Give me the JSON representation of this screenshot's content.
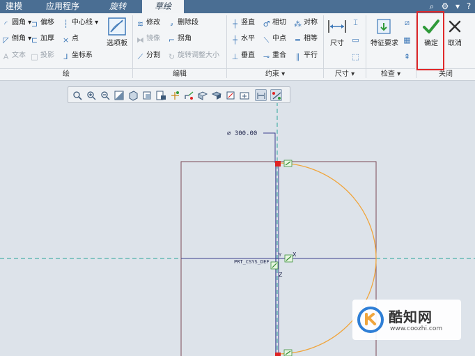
{
  "tabs": [
    {
      "label": "建模"
    },
    {
      "label": "应用程序"
    },
    {
      "label": "旋转"
    },
    {
      "label": "草绘"
    }
  ],
  "ribbon": {
    "sketch_group": {
      "footer": "绘",
      "items": [
        {
          "label": "圆角",
          "icon": "fillet-icon"
        },
        {
          "label": "倒角",
          "icon": "chamfer-icon"
        },
        {
          "label": "文本",
          "icon": "text-icon"
        },
        {
          "label": "偏移",
          "icon": "offset-icon"
        },
        {
          "label": "加厚",
          "icon": "thicken-icon"
        },
        {
          "label": "投影",
          "icon": "project-icon"
        },
        {
          "label": "中心线",
          "icon": "centerline-icon"
        },
        {
          "label": "点",
          "icon": "point-icon"
        },
        {
          "label": "坐标系",
          "icon": "coord-sys-icon"
        }
      ],
      "palette_label": "选项板"
    },
    "edit_group": {
      "footer": "编辑",
      "items": [
        {
          "label": "修改",
          "icon": "modify-icon"
        },
        {
          "label": "镜像",
          "icon": "mirror-icon"
        },
        {
          "label": "分割",
          "icon": "divide-icon"
        },
        {
          "label": "删除段",
          "icon": "delete-segment-icon"
        },
        {
          "label": "拐角",
          "icon": "corner-icon"
        },
        {
          "label": "旋转调整大小",
          "icon": "rotate-resize-icon"
        }
      ]
    },
    "constraint_group": {
      "footer": "约束",
      "items": [
        {
          "label": "竖直",
          "icon": "vertical-icon"
        },
        {
          "label": "水平",
          "icon": "horizontal-icon"
        },
        {
          "label": "垂直",
          "icon": "perpendicular-icon"
        },
        {
          "label": "相切",
          "icon": "tangent-icon"
        },
        {
          "label": "中点",
          "icon": "midpoint-icon"
        },
        {
          "label": "重合",
          "icon": "coincident-icon"
        },
        {
          "label": "对称",
          "icon": "symmetric-icon"
        },
        {
          "label": "相等",
          "icon": "equal-icon"
        },
        {
          "label": "平行",
          "icon": "parallel-icon"
        }
      ]
    },
    "dimension_group": {
      "footer": "尺寸",
      "label": "尺寸"
    },
    "inspect_group": {
      "footer": "检查",
      "label": "特征要求"
    },
    "close_group": {
      "footer": "关闭",
      "ok_label": "确定",
      "cancel_label": "取消"
    }
  },
  "canvas": {
    "dimension_text": "⌀ 300.00",
    "csys_label": "PRT_CSYS_DEF",
    "axis_x": "X",
    "axis_y": "Y",
    "axis_z": "Z"
  },
  "watermark": {
    "name": "酷知网",
    "url": "www.coozhi.com"
  },
  "colors": {
    "tabbar": "#4a6e93",
    "ribbon_bg": "#f3f5f7",
    "canvas_bg": "#dde3ea",
    "arc": "#f0a53c",
    "highlight_box": "#e0282a",
    "ok_check": "#2f9a3a",
    "centerline": "#2aa59a"
  }
}
